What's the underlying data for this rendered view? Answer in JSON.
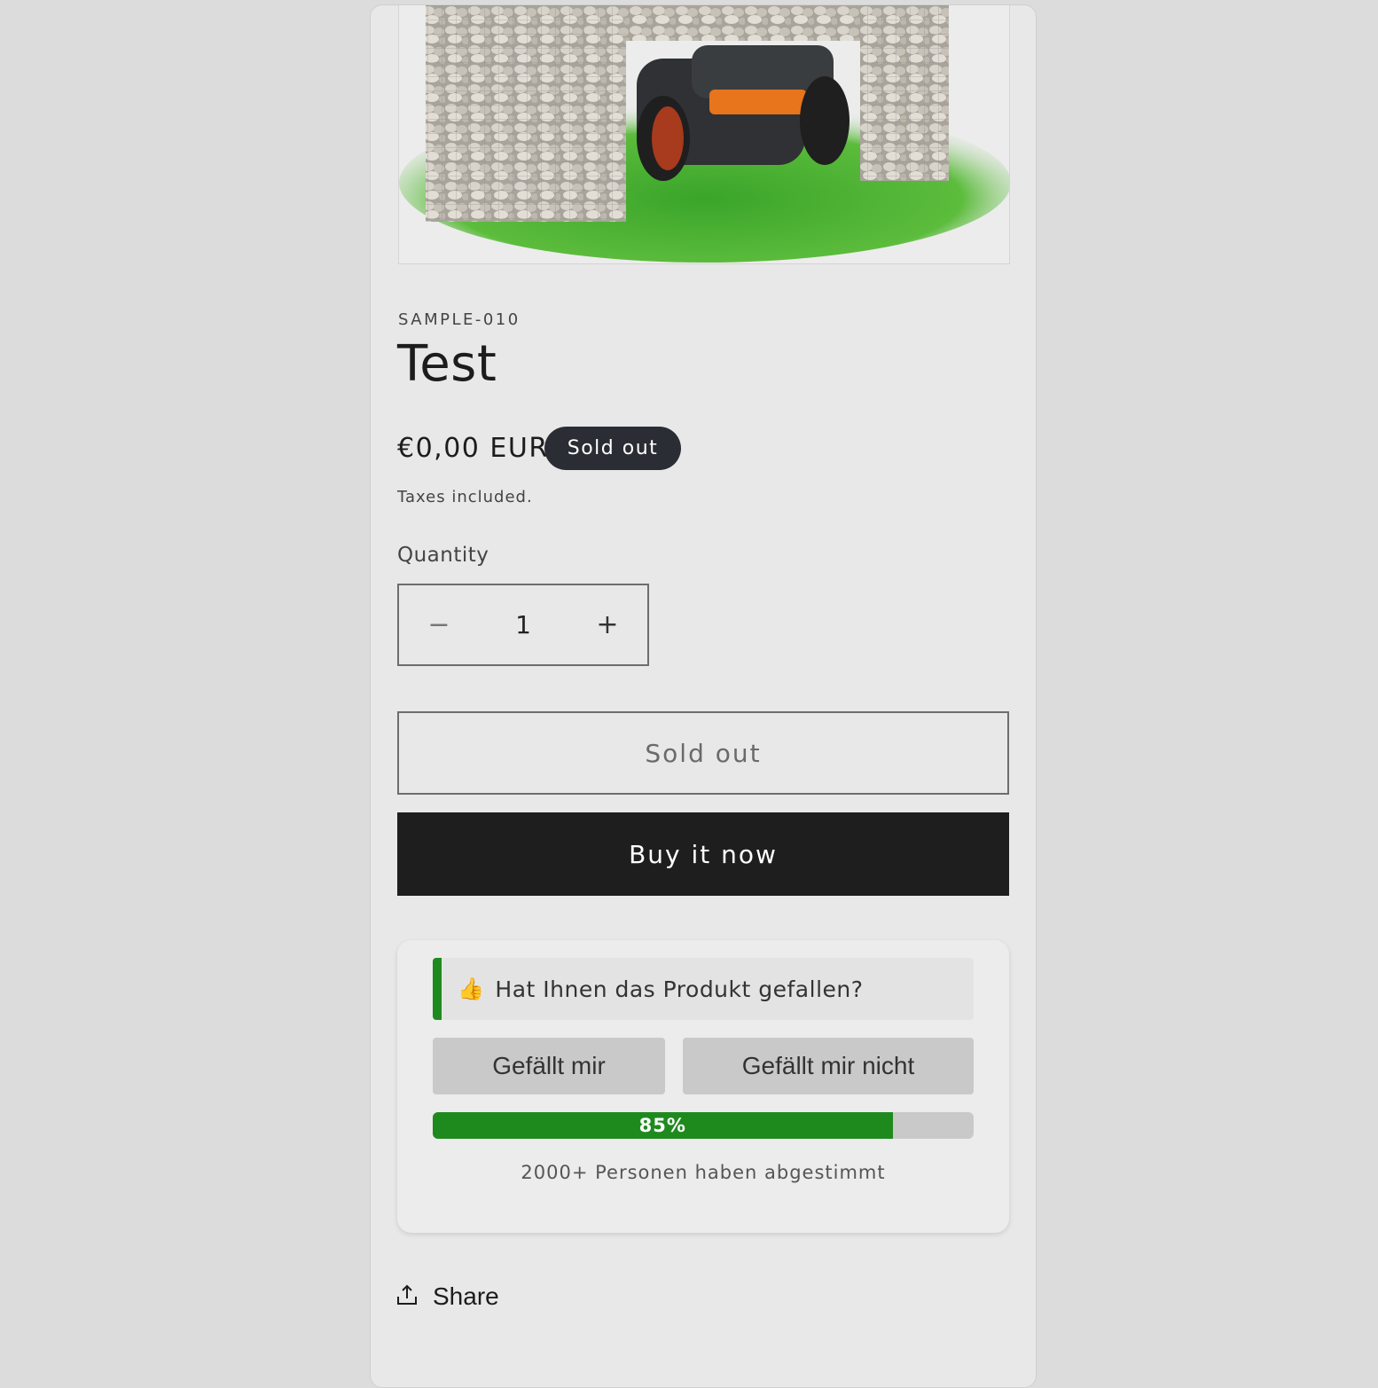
{
  "product": {
    "sku": "SAMPLE-010",
    "title": "Test",
    "price": "€0,00 EUR",
    "badge": "Sold out",
    "taxes": "Taxes included."
  },
  "quantity": {
    "label": "Quantity",
    "value": "1",
    "minus": "−",
    "plus": "+"
  },
  "buttons": {
    "sold_out": "Sold out",
    "buy_now": "Buy it now"
  },
  "poll": {
    "question": "Hat Ihnen das Produkt gefallen?",
    "like": "Gefällt mir",
    "dislike": "Gefällt mir nicht",
    "percent_label": "85%",
    "percent_value": 0.85,
    "votes": "2000+ Personen haben abgestimmt",
    "accent_color": "#1e8a1e"
  },
  "share": {
    "label": "Share",
    "icon": "share-upload-icon"
  }
}
